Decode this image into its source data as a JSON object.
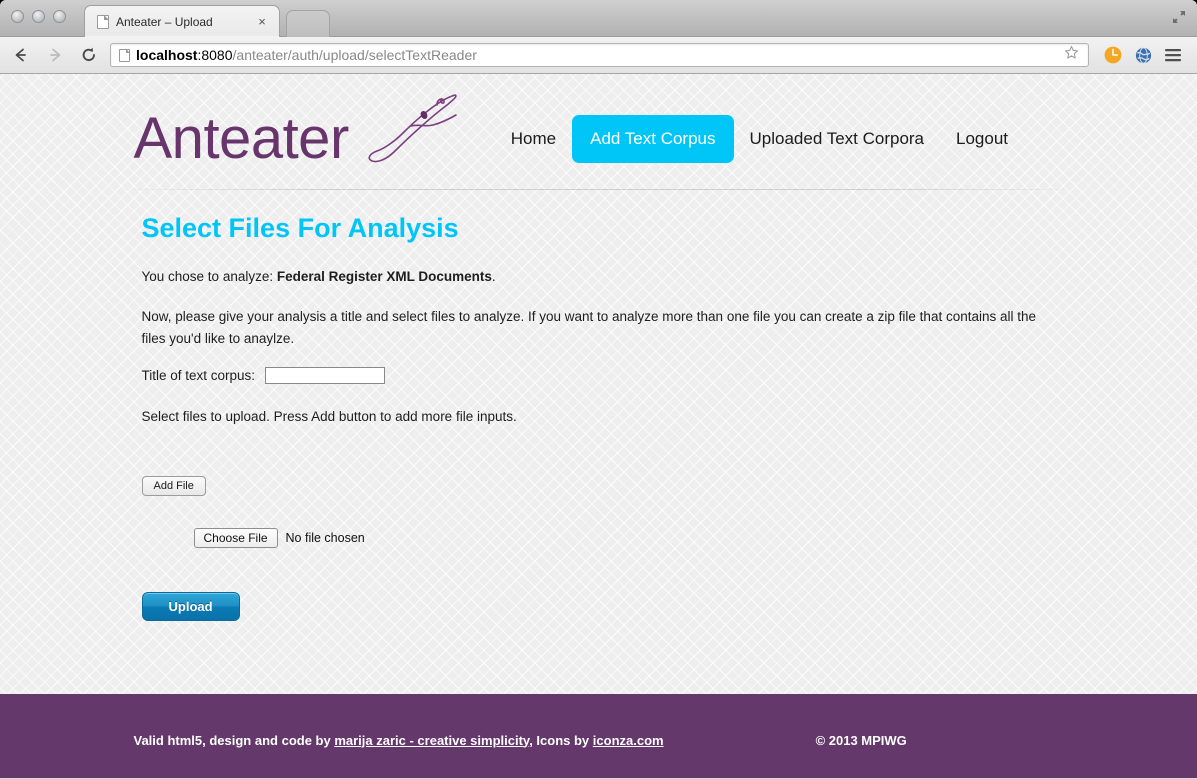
{
  "browser": {
    "tab": {
      "title": "Anteater – Upload",
      "close_label": "×"
    },
    "url": {
      "host_main": "localhost",
      "host_port": ":8080",
      "path": "/anteater/auth/upload/selectTextReader"
    },
    "icons": {
      "back": "back-arrow-icon",
      "forward": "forward-arrow-icon",
      "reload": "reload-icon",
      "star": "bookmark-star-icon",
      "extension": "orange-clock-extension-icon",
      "globe": "globe-extension-icon",
      "menu": "hamburger-menu-icon",
      "expand": "fullscreen-expand-icon"
    }
  },
  "site": {
    "brand": "Anteater",
    "nav": [
      {
        "label": "Home",
        "active": false
      },
      {
        "label": "Add Text Corpus",
        "active": true
      },
      {
        "label": "Uploaded Text Corpora",
        "active": false
      },
      {
        "label": "Logout",
        "active": false
      }
    ]
  },
  "main": {
    "page_title": "Select Files For Analysis",
    "chose_prefix": "You chose to analyze: ",
    "chose_value": "Federal Register XML Documents",
    "chose_suffix": ".",
    "instructions": "Now, please give your analysis a title and select files to analyze. If you want to analyze more than one file you can create a zip file that contains all the files you'd like to anaylze.",
    "title_label": "Title of text corpus:",
    "title_value": "",
    "title_placeholder": "",
    "select_files_text": "Select files to upload. Press Add button to add more file inputs.",
    "add_file_label": "Add File",
    "choose_file_label": "Choose File",
    "file_status": "No file chosen",
    "upload_label": "Upload"
  },
  "footer": {
    "credits_prefix": "Valid html5, design and code by ",
    "credits_link1": "marija zaric - creative simplicity",
    "credits_middle": ", Icons by ",
    "credits_link2": "iconza.com",
    "copyright": "© 2013 MPIWG"
  },
  "colors": {
    "brand_purple": "#67356c",
    "accent_cyan": "#00c6f8",
    "footer_purple": "#64386a",
    "upload_blue": "#0b7ab3",
    "page_bg": "#eeeeee"
  }
}
